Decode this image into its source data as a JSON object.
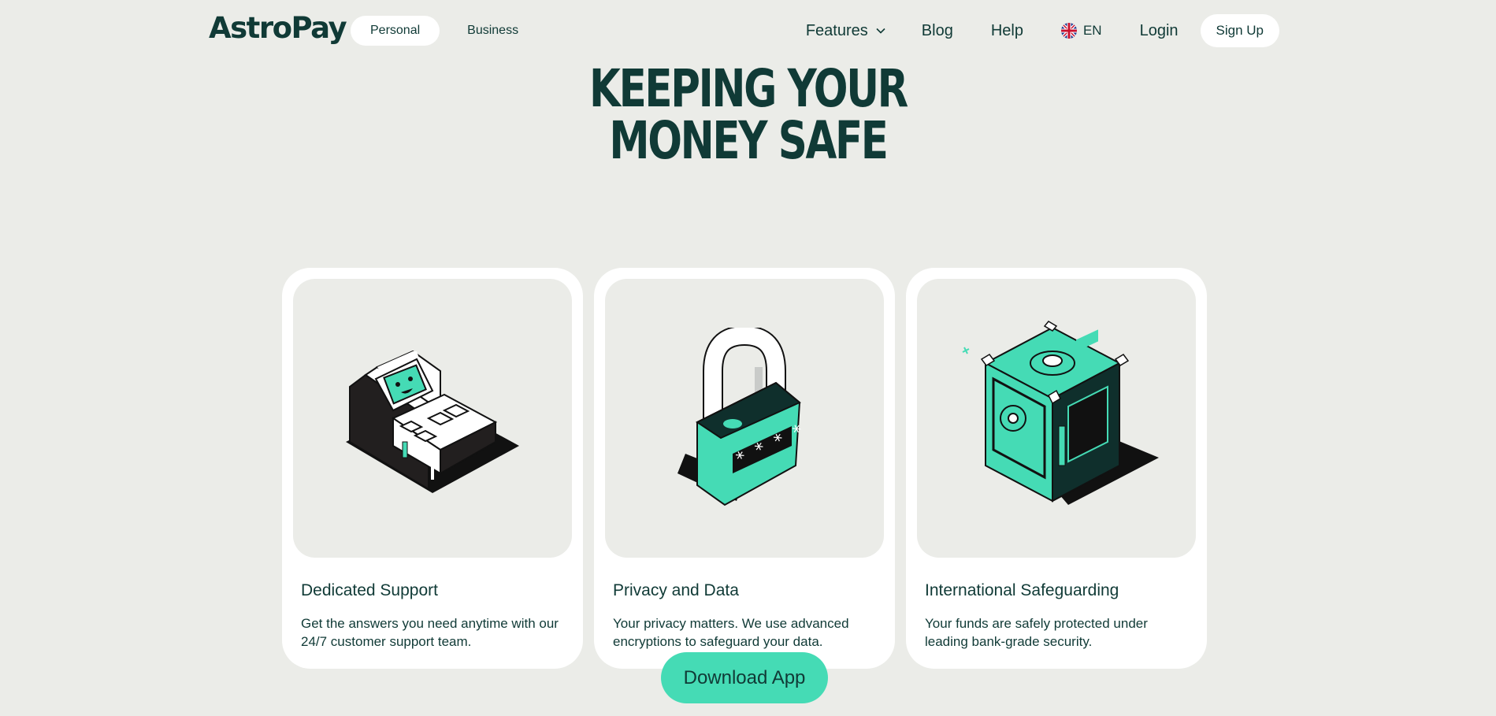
{
  "brand": {
    "logo_text": "AstroPay",
    "accent": "#45dbb5",
    "dark": "#103a36",
    "background": "#ebece8"
  },
  "nav": {
    "segments": [
      {
        "label": "Personal",
        "active": true
      },
      {
        "label": "Business",
        "active": false
      }
    ],
    "features_label": "Features",
    "blog_label": "Blog",
    "help_label": "Help",
    "language_label": "EN",
    "login_label": "Login",
    "signup_label": "Sign Up"
  },
  "hero": {
    "line1": "KEEPING YOUR",
    "line2": "MONEY SAFE"
  },
  "cards": [
    {
      "title": "Dedicated Support",
      "description": "Get the answers you need anytime with our 24/7 customer support team.",
      "icon": "support-terminal-icon"
    },
    {
      "title": "Privacy and Data",
      "description": "Your privacy matters. We use advanced encryptions to safeguard your data.",
      "icon": "padlock-icon"
    },
    {
      "title": "International Safeguarding",
      "description": "Your funds are safely protected under leading bank-grade security.",
      "icon": "safe-box-icon"
    }
  ],
  "cta": {
    "download_label": "Download App"
  },
  "lock_code": "* * * *"
}
